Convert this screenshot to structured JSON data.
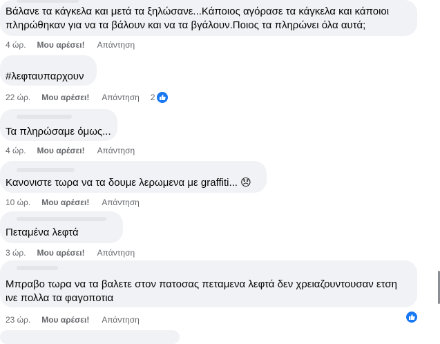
{
  "comments": [
    {
      "lines": [
        "Βάλανε τα κάγκελα και μετά τα ξηλώσανε...Κάποιος αγόρασε τα κάγκελα και κάποιοι",
        "πληρώθηκαν για να τα βάλουν και να τα βγάλουν.Ποιος τα πληρώνει όλα αυτά;"
      ],
      "time": "4 ώρ.",
      "like": "Μου αρέσει!",
      "reply": "Απάντηση"
    },
    {
      "lines": [
        "#λεφταυπαρχουν"
      ],
      "time": "22 ώρ.",
      "like": "Μου αρέσει!",
      "reply": "Απάντηση",
      "reaction_count": "2"
    },
    {
      "lines": [
        "Τα πληρώσαμε όμως..."
      ],
      "time": "4 ώρ.",
      "like": "Μου αρέσει!",
      "reply": "Απάντηση"
    },
    {
      "lines": [
        "Κανονιστε τωρα να τα δουμε λερωμενα με graffiti... 😞"
      ],
      "time": "10 ώρ.",
      "like": "Μου αρέσει!",
      "reply": "Απάντηση"
    },
    {
      "lines": [
        "Πεταμένα λεφτά"
      ],
      "time": "3 ώρ.",
      "like": "Μου αρέσει!",
      "reply": "Απάντηση"
    },
    {
      "lines": [
        "Μπραβο τωρα να τα βαλετε στον πατοσας πεταμενα λεφτά δεν χρειαζουντουσαν ετση",
        "ινε πολλα τα φαγοποτια"
      ],
      "time": "23 ώρ.",
      "like": "Μου αρέσει!",
      "reply": "Απάντηση"
    }
  ],
  "colors": {
    "bubble": "#f0f2f5",
    "meta_text": "#65676b",
    "like_blue": "#1877f2"
  },
  "icons": [
    "like-reaction-icon"
  ]
}
